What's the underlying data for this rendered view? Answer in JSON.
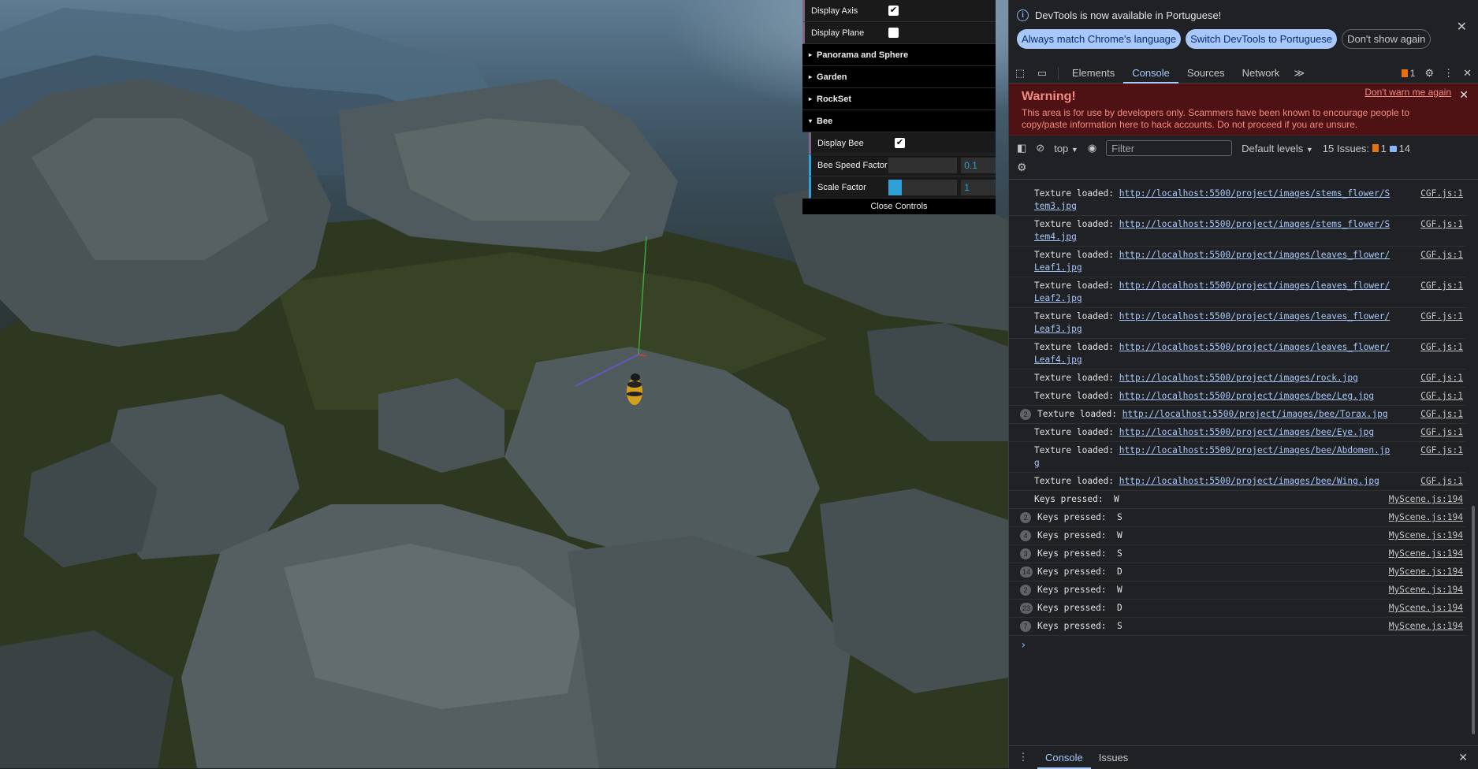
{
  "gui": {
    "rows": [
      {
        "label": "Display Axis",
        "checked": true
      },
      {
        "label": "Display Plane",
        "checked": false
      }
    ],
    "folders": [
      "Panorama and Sphere",
      "Garden",
      "RockSet"
    ],
    "bee_folder": "Bee",
    "bee_rows": {
      "display_bee": {
        "label": "Display Bee",
        "checked": true
      },
      "speed": {
        "label": "Bee Speed Factor",
        "value": "0.1",
        "level": 0
      },
      "scale": {
        "label": "Scale Factor",
        "value": "1",
        "level": 0.2
      }
    },
    "close_label": "Close Controls",
    "check_glyph": "✔",
    "triangle_closed": "▸",
    "triangle_open": "▾"
  },
  "devtools": {
    "info": {
      "message": "DevTools is now available in Portuguese!",
      "icon": "i",
      "btn_match": "Always match Chrome's language",
      "btn_switch": "Switch DevTools to Portuguese",
      "btn_dont": "Don't show again"
    },
    "tabs": [
      "Elements",
      "Console",
      "Sources",
      "Network"
    ],
    "more_tabs": "≫",
    "issues_count": "1",
    "warning": {
      "title": "Warning!",
      "text": "This area is for use by developers only. Scammers have been known to encourage people to copy/paste information here to hack accounts. Do not proceed if you are unsure.",
      "dont_warn": "Don't warn me again"
    },
    "console_toolbar": {
      "context": "top",
      "filter_placeholder": "Filter",
      "levels": "Default levels",
      "issues_label": "15 Issues:",
      "issues_warn": "1",
      "issues_info": "14"
    },
    "logs": [
      {
        "prefix": "Texture loaded: ",
        "link": "http://localhost:5500/project/images/stems_flower/Stem3.jpg",
        "src": "CGF.js:1",
        "count": ""
      },
      {
        "prefix": "Texture loaded: ",
        "link": "http://localhost:5500/project/images/stems_flower/Stem4.jpg",
        "src": "CGF.js:1",
        "count": ""
      },
      {
        "prefix": "Texture loaded: ",
        "link": "http://localhost:5500/project/images/leaves_flower/Leaf1.jpg",
        "src": "CGF.js:1",
        "count": ""
      },
      {
        "prefix": "Texture loaded: ",
        "link": "http://localhost:5500/project/images/leaves_flower/Leaf2.jpg",
        "src": "CGF.js:1",
        "count": ""
      },
      {
        "prefix": "Texture loaded: ",
        "link": "http://localhost:5500/project/images/leaves_flower/Leaf3.jpg",
        "src": "CGF.js:1",
        "count": ""
      },
      {
        "prefix": "Texture loaded: ",
        "link": "http://localhost:5500/project/images/leaves_flower/Leaf4.jpg",
        "src": "CGF.js:1",
        "count": ""
      },
      {
        "prefix": "Texture loaded: ",
        "link": "http://localhost:5500/project/images/rock.jpg",
        "src": "CGF.js:1",
        "count": ""
      },
      {
        "prefix": "Texture loaded: ",
        "link": "http://localhost:5500/project/images/bee/Leg.jpg",
        "src": "CGF.js:1",
        "count": ""
      },
      {
        "prefix": "Texture loaded: ",
        "link": "http://localhost:5500/project/images/bee/Torax.jpg",
        "src": "CGF.js:1",
        "count": "2"
      },
      {
        "prefix": "Texture loaded: ",
        "link": "http://localhost:5500/project/images/bee/Eye.jpg",
        "src": "CGF.js:1",
        "count": ""
      },
      {
        "prefix": "Texture loaded: ",
        "link": "http://localhost:5500/project/images/bee/Abdomen.jpg",
        "src": "CGF.js:1",
        "count": ""
      },
      {
        "prefix": "Texture loaded: ",
        "link": "http://localhost:5500/project/images/bee/Wing.jpg",
        "src": "CGF.js:1",
        "count": ""
      },
      {
        "prefix": "Keys pressed:  W",
        "link": "",
        "src": "MyScene.js:194",
        "count": ""
      },
      {
        "prefix": "Keys pressed:  S",
        "link": "",
        "src": "MyScene.js:194",
        "count": "2"
      },
      {
        "prefix": "Keys pressed:  W",
        "link": "",
        "src": "MyScene.js:194",
        "count": "4"
      },
      {
        "prefix": "Keys pressed:  S",
        "link": "",
        "src": "MyScene.js:194",
        "count": "3"
      },
      {
        "prefix": "Keys pressed:  D",
        "link": "",
        "src": "MyScene.js:194",
        "count": "14"
      },
      {
        "prefix": "Keys pressed:  W",
        "link": "",
        "src": "MyScene.js:194",
        "count": "2"
      },
      {
        "prefix": "Keys pressed:  D",
        "link": "",
        "src": "MyScene.js:194",
        "count": "23"
      },
      {
        "prefix": "Keys pressed:  S",
        "link": "",
        "src": "MyScene.js:194",
        "count": "7"
      }
    ],
    "prompt_glyph": "›",
    "drawer_tabs": [
      "Console",
      "Issues"
    ],
    "icons": {
      "close": "✕",
      "inspect": "⬚",
      "device": "▭",
      "settings": "⚙",
      "kebab": "⋮",
      "sidebar": "◧",
      "clear": "⊘",
      "eye": "◉",
      "dropdown": "▼"
    }
  },
  "colors": {
    "gui_bool_accent": "#806787",
    "gui_number_accent": "#2fa1d6",
    "devtools_accent": "#a8c7fa",
    "warning_bg": "#4e1114"
  }
}
